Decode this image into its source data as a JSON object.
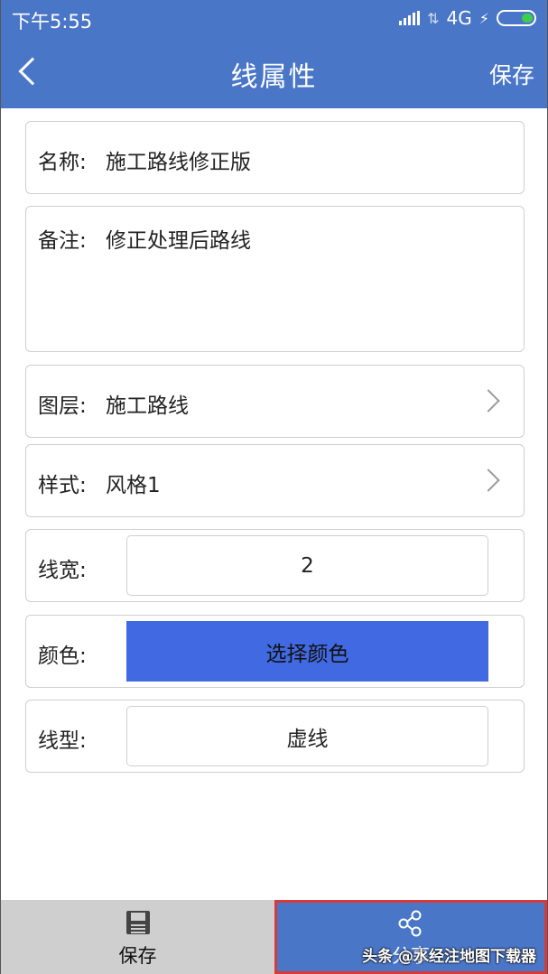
{
  "status": {
    "time": "下午5:55",
    "network": "4G",
    "battery_color": "#3ecf4a"
  },
  "header": {
    "title": "线属性",
    "save_label": "保存",
    "background": "#4a76c8"
  },
  "form": {
    "name": {
      "label": "名称:",
      "value": "施工路线修正版"
    },
    "note": {
      "label": "备注:",
      "value": "修正处理后路线"
    },
    "layer": {
      "label": "图层:",
      "value": "施工路线"
    },
    "style": {
      "label": "样式:",
      "value": "风格1"
    },
    "line_width": {
      "label": "线宽:",
      "value": "2"
    },
    "color": {
      "label": "颜色:",
      "button_label": "选择颜色",
      "swatch": "#4169e1"
    },
    "line_type": {
      "label": "线型:",
      "value": "虚线"
    }
  },
  "bottom_bar": {
    "save_label": "保存",
    "share_label": "分享",
    "save_icon": "floppy-disk-icon",
    "share_icon": "share-icon"
  },
  "watermark": "头条 @水经注地图下载器"
}
